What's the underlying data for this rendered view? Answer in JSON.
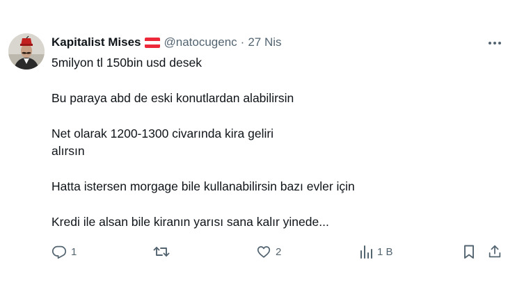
{
  "author": {
    "display_name": "Kapitalist Mises",
    "handle": "@natocugenc",
    "separator": "·",
    "date": "27 Nis",
    "flag": "austria-flag-icon",
    "avatar": "avatar-portrait-red-fez"
  },
  "tweet": {
    "paragraphs": [
      "5milyon tl 150bin usd desek",
      "Bu paraya abd de eski konutlardan alabilirsin",
      "Net olarak 1200-1300 civarında kira geliri",
      "alırsın",
      "Hatta istersen morgage bile kullanabilirsin bazı evler için",
      "Kredi ile alsan bile kiranın yarısı sana kalır yinede..."
    ]
  },
  "actions": {
    "reply_count": "1",
    "retweet_count": "",
    "like_count": "2",
    "views_count": "1 B"
  },
  "colors": {
    "text": "#0f1419",
    "secondary": "#536471",
    "flag_red": "#ed2939"
  }
}
